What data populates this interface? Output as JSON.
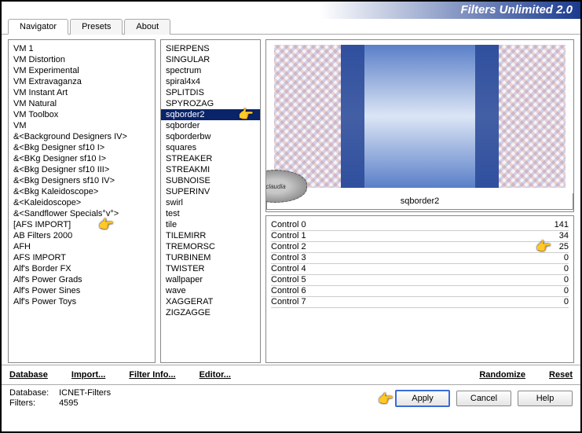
{
  "title": "Filters Unlimited 2.0",
  "tabs": [
    "Navigator",
    "Presets",
    "About"
  ],
  "activeTab": 0,
  "categories": [
    "VM 1",
    "VM Distortion",
    "VM Experimental",
    "VM Extravaganza",
    "VM Instant Art",
    "VM Natural",
    "VM Toolbox",
    "VM",
    "&<Background Designers IV>",
    "&<Bkg Designer sf10 I>",
    "&<BKg Designer sf10 I>",
    "&<Bkg Designer sf10 III>",
    "&<Bkg Designers sf10 IV>",
    "&<Bkg Kaleidoscope>",
    "&<Kaleidoscope>",
    "&<Sandflower Specials°v°>",
    "[AFS IMPORT]",
    "AB Filters 2000",
    "AFH",
    "AFS IMPORT",
    "Alf's Border FX",
    "Alf's Power Grads",
    "Alf's Power Sines",
    "Alf's Power Toys"
  ],
  "selectedCategoryIndex": 16,
  "filters": [
    "SIERPENS",
    "SINGULAR",
    "spectrum",
    "spiral4x4",
    "SPLITDIS",
    "SPYROZAG",
    "sqborder2",
    "sqborder",
    "sqborderbw",
    "squares",
    "STREAKER",
    "STREAKMI",
    "SUBNOISE",
    "SUPERINV",
    "swirl",
    "test",
    "tile",
    "TILEMIRR",
    "TREMORSC",
    "TURBINEM",
    "TWISTER",
    "wallpaper",
    "wave",
    "XAGGERAT",
    "ZIGZAGGE"
  ],
  "selectedFilterIndex": 6,
  "currentFilterName": "sqborder2",
  "controls": [
    {
      "label": "Control 0",
      "value": 141
    },
    {
      "label": "Control 1",
      "value": 34
    },
    {
      "label": "Control 2",
      "value": 25
    },
    {
      "label": "Control 3",
      "value": 0
    },
    {
      "label": "Control 4",
      "value": 0
    },
    {
      "label": "Control 5",
      "value": 0
    },
    {
      "label": "Control 6",
      "value": 0
    },
    {
      "label": "Control 7",
      "value": 0
    }
  ],
  "highlightControlIndex": 2,
  "bottomLinks": {
    "database": "Database",
    "import": "Import...",
    "filterInfo": "Filter Info...",
    "editor": "Editor...",
    "randomize": "Randomize",
    "reset": "Reset"
  },
  "status": {
    "databaseLabel": "Database:",
    "databaseValue": "ICNET-Filters",
    "filtersLabel": "Filters:",
    "filtersValue": "4595"
  },
  "buttons": {
    "apply": "Apply",
    "cancel": "Cancel",
    "help": "Help"
  },
  "stamp": "claudia"
}
